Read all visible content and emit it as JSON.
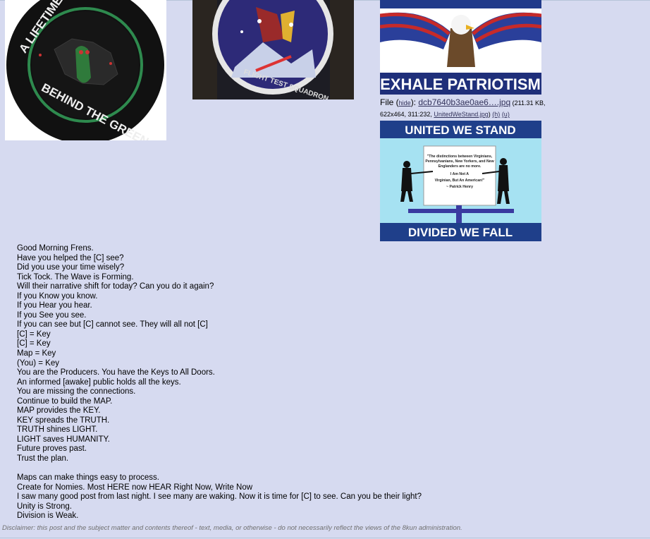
{
  "images": {
    "img1_text": [
      "A LIFETIME OF SILENCE",
      "BEHIND THE GREEN DOOR"
    ],
    "img2_text": "FLIGHT TEST SQUADRON",
    "img3_text": "EXHALE PATRIOTISM",
    "img4": {
      "top": "UNITED WE STAND",
      "bottom": "DIVIDED WE FALL",
      "quote": [
        "\"The distinctions between Virginians,",
        "Pennsylvanians, New Yorkers, and New",
        "Englanders are no more.",
        "I Am Not A",
        "Virginian, But An American!\"",
        "~ Patrick Henry"
      ]
    }
  },
  "file": {
    "label": "File (",
    "hide": "hide",
    "sep": "): ",
    "name": "dcb7640b3ae0ae6….jpq",
    "meta1": " (211.31 KB,",
    "meta2": "622x464, 311:232, ",
    "orig": "UnitedWeStand.jpg",
    "close": ") ",
    "h": "(h)",
    "u": "(u)"
  },
  "post": {
    "lines": [
      "Good Morning Frens.",
      "Have you helped the [C] see?",
      "Did you use your time wisely?",
      "Tick Tock. The Wave is Forming.",
      "Will their narrative shift for today? Can you do it again?",
      "If you Know you know.",
      "If you Hear you hear.",
      "If you See you see.",
      "If you can see but [C] cannot see. They will all not [C]",
      "[C] = Key",
      "[C] = Key",
      "Map = Key",
      "(You) = Key",
      "You are the Producers. You have the Keys to All Doors.",
      "An informed [awake] public holds all the keys.",
      "You are missing the connections.",
      "Continue to build the MAP.",
      "MAP provides the KEY.",
      "KEY spreads the TRUTH.",
      "TRUTH shines LIGHT.",
      "LIGHT saves HUMANITY.",
      "Future proves past.",
      "Trust the plan.",
      "",
      "Maps can make things easy to process.",
      "Create for Nomies. Most HERE now HEAR Right Now, Write Now",
      "I saw many good post from last night. I see many are waking. Now it is time for [C] to see. Can you be their light?",
      "Unity is Strong.",
      "Division is Weak."
    ]
  },
  "disclaimer": "Disclaimer: this post and the subject matter and contents thereof - text, media, or otherwise - do not necessarily reflect the views of the 8kun administration."
}
